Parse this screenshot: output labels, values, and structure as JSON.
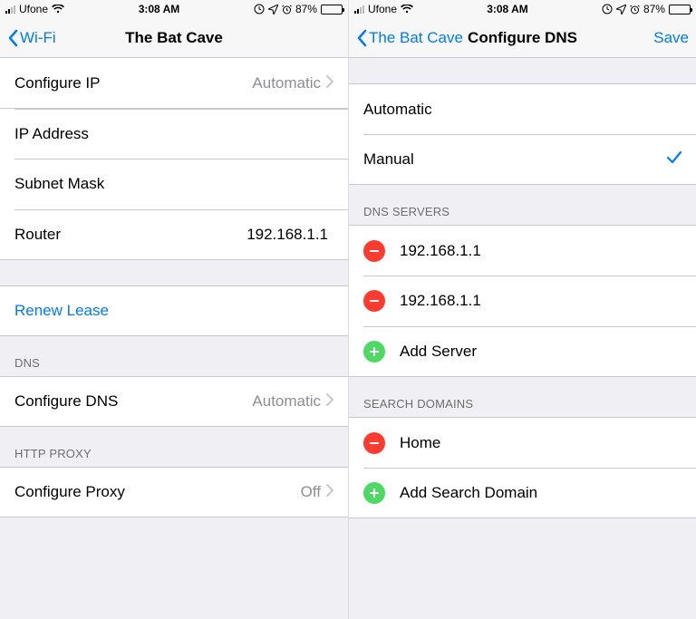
{
  "status": {
    "carrier": "Ufone",
    "time": "3:08 AM",
    "battery_pct": "87%"
  },
  "left": {
    "back_label": "Wi-Fi",
    "title": "The Bat Cave",
    "rows": {
      "configure_ip_label": "Configure IP",
      "configure_ip_value": "Automatic",
      "ip_address_label": "IP Address",
      "subnet_mask_label": "Subnet Mask",
      "router_label": "Router",
      "router_value": "192.168.1.1",
      "renew_lease_label": "Renew Lease",
      "dns_header": "DNS",
      "configure_dns_label": "Configure DNS",
      "configure_dns_value": "Automatic",
      "http_proxy_header": "HTTP PROXY",
      "configure_proxy_label": "Configure Proxy",
      "configure_proxy_value": "Off"
    }
  },
  "right": {
    "back_label": "The Bat Cave",
    "title": "Configure DNS",
    "save_label": "Save",
    "options": {
      "automatic": "Automatic",
      "manual": "Manual"
    },
    "dns_servers_header": "DNS SERVERS",
    "dns_servers": [
      "192.168.1.1",
      "192.168.1.1"
    ],
    "add_server_label": "Add Server",
    "search_domains_header": "SEARCH DOMAINS",
    "search_domains": [
      "Home"
    ],
    "add_search_domain_label": "Add Search Domain"
  }
}
